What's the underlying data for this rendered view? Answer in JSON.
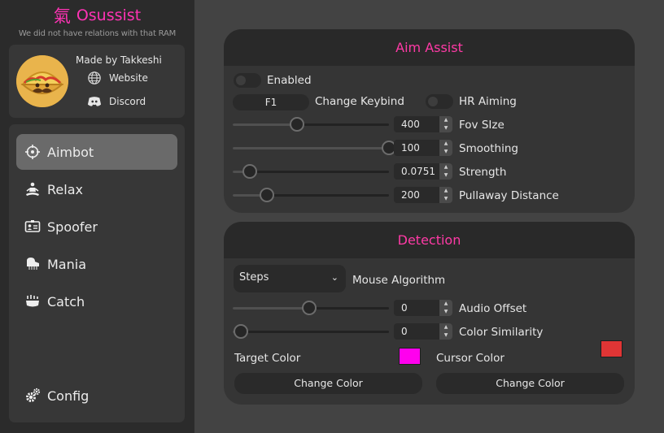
{
  "brand": {
    "title": "Osussist",
    "glyph": "氣",
    "subtitle": "We did not have relations with that RAM"
  },
  "profile": {
    "made_by": "Made by Takkeshi",
    "website": "Website",
    "discord": "Discord"
  },
  "nav": {
    "items": [
      {
        "label": "Aimbot",
        "icon": "crosshair-icon",
        "active": true
      },
      {
        "label": "Relax",
        "icon": "meditation-icon",
        "active": false
      },
      {
        "label": "Spoofer",
        "icon": "id-card-icon",
        "active": false
      },
      {
        "label": "Mania",
        "icon": "piano-icon",
        "active": false
      },
      {
        "label": "Catch",
        "icon": "catch-icon",
        "active": false
      }
    ],
    "config": {
      "label": "Config",
      "icon": "gears-icon"
    }
  },
  "aim_assist": {
    "title": "Aim Assist",
    "enabled_label": "Enabled",
    "enabled": false,
    "keybind_value": "F1",
    "keybind_label": "Change Keybind",
    "hr_aiming_label": "HR Aiming",
    "hr_aiming": false,
    "sliders": [
      {
        "label": "Fov SIze",
        "value": "400",
        "fraction": 0.41
      },
      {
        "label": "Smoothing",
        "value": "100",
        "fraction": 1.0
      },
      {
        "label": "Strength",
        "value": "0.0751",
        "fraction": 0.11
      },
      {
        "label": "Pullaway Distance",
        "value": "200",
        "fraction": 0.22
      }
    ]
  },
  "detection": {
    "title": "Detection",
    "algorithm_value": "Steps",
    "algorithm_label": "Mouse Algorithm",
    "sliders": [
      {
        "label": "Audio Offset",
        "value": "0",
        "fraction": 0.49
      },
      {
        "label": "Color Similarity",
        "value": "0",
        "fraction": 0.05
      }
    ],
    "target_color_label": "Target Color",
    "target_color": "#ff00ee",
    "cursor_color_label": "Cursor Color",
    "cursor_color": "#e03535",
    "change_color_label": "Change Color"
  },
  "colors": {
    "accent": "#ff33b5",
    "panel": "#353535",
    "panel_header": "#292929",
    "sidebar": "#2b2b2b"
  }
}
